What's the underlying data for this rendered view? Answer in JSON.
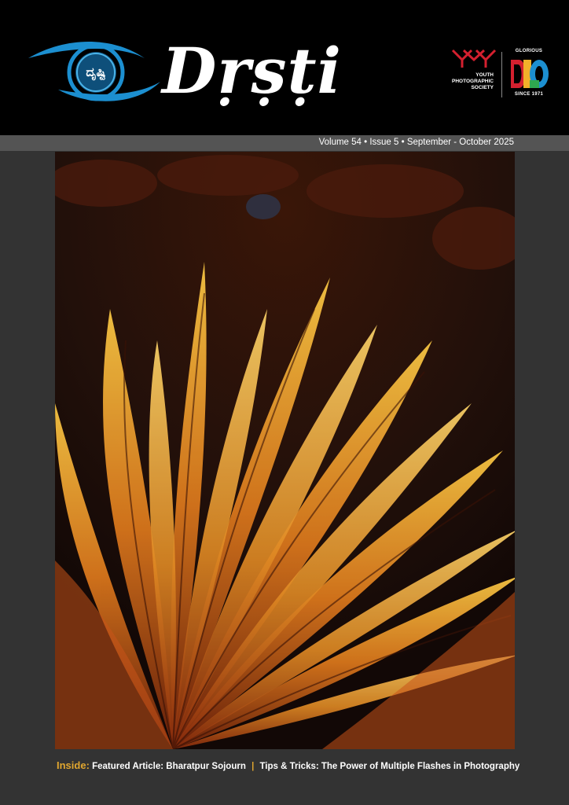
{
  "masthead": {
    "logo_glyph": "ದೃಷ್ಟಿ",
    "title": "Dṛṣṭi",
    "publisher_line1": "YOUTH",
    "publisher_line2": "PHOTOGRAPHIC",
    "publisher_line3": "SOCIETY",
    "anniversary_top": "GLORIOUS",
    "anniversary_bottom": "SINCE 1971"
  },
  "issue": {
    "text": "Volume 54 • Issue 5 • September - October 2025"
  },
  "inside": {
    "label": "Inside:",
    "item1": "Featured Article: Bharatpur Sojourn",
    "separator": "|",
    "item2": "Tips & Tricks: The Power of Multiple Flashes in Photography"
  },
  "colors": {
    "page_background": "#333333",
    "masthead_background": "#000000",
    "issue_strip": "#545454",
    "accent_gold": "#e0a62f",
    "eye_blue": "#1c8fd0",
    "yps_red": "#d4202f"
  }
}
